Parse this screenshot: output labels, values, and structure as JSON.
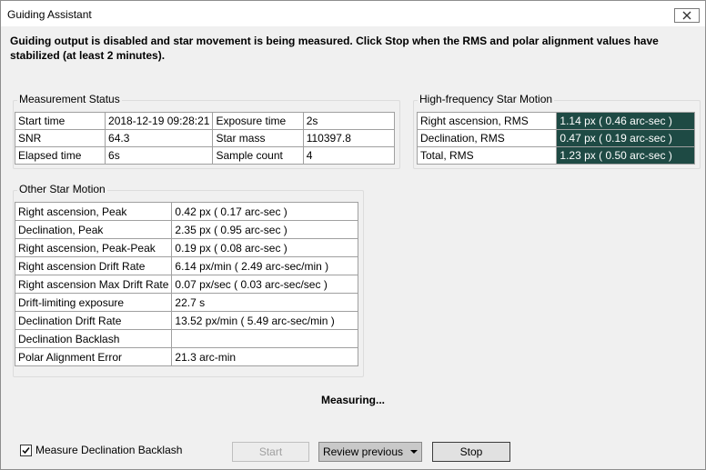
{
  "window": {
    "title": "Guiding Assistant"
  },
  "intro": "Guiding output is disabled and star movement is being measured.  Click Stop when the RMS and polar alignment values have stabilized (at least 2 minutes).",
  "measurement_status": {
    "title": "Measurement Status",
    "rows": [
      [
        "Start time",
        "2018-12-19 09:28:21",
        "Exposure time",
        "2s"
      ],
      [
        "SNR",
        "64.3",
        "Star mass",
        "110397.8"
      ],
      [
        "Elapsed time",
        "6s",
        "Sample count",
        "4"
      ]
    ]
  },
  "high_freq": {
    "title": "High-frequency Star Motion",
    "rows": [
      [
        "Right ascension, RMS",
        "1.14 px (  0.46 arc-sec )"
      ],
      [
        "Declination, RMS",
        "0.47 px (  0.19 arc-sec )"
      ],
      [
        "Total, RMS",
        "1.23 px (  0.50 arc-sec )"
      ]
    ]
  },
  "other_motion": {
    "title": "Other Star Motion",
    "rows": [
      [
        "Right ascension, Peak",
        "0.42 px (  0.17 arc-sec )"
      ],
      [
        "Declination, Peak",
        "2.35 px (  0.95 arc-sec )"
      ],
      [
        "Right ascension, Peak-Peak",
        "0.19 px (  0.08 arc-sec )"
      ],
      [
        "Right ascension Drift Rate",
        "6.14 px/min (  2.49 arc-sec/min )"
      ],
      [
        "Right ascension Max Drift Rate",
        "0.07 px/sec (  0.03 arc-sec/sec )"
      ],
      [
        "Drift-limiting exposure",
        "22.7 s"
      ],
      [
        "Declination Drift Rate",
        "13.52 px/min (  5.49 arc-sec/min )"
      ],
      [
        "Declination Backlash",
        ""
      ],
      [
        "Polar Alignment Error",
        "21.3 arc-min"
      ]
    ]
  },
  "status_text": "Measuring...",
  "checkbox": {
    "label": "Measure Declination Backlash",
    "checked": true
  },
  "buttons": {
    "start": "Start",
    "review": "Review previous",
    "stop": "Stop"
  }
}
